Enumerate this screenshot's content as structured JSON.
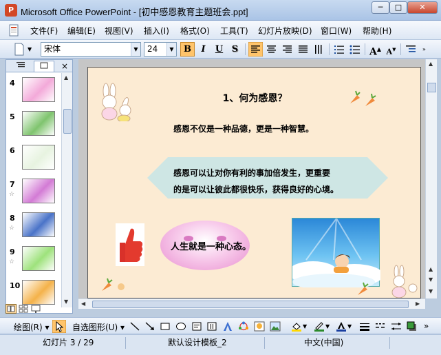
{
  "window": {
    "app_icon": "powerpoint-icon",
    "title": "Microsoft Office PowerPoint - [初中感恩教育主题班会.ppt]"
  },
  "menu": [
    "文件(F)",
    "编辑(E)",
    "视图(V)",
    "插入(I)",
    "格式(O)",
    "工具(T)",
    "幻灯片放映(D)",
    "窗口(W)",
    "帮助(H)"
  ],
  "toolbar": {
    "font_name": "宋体",
    "font_size": "24",
    "bold": "B",
    "italic": "I",
    "underline": "U",
    "shadow": "S",
    "grow_font": "A",
    "shrink_font": "A"
  },
  "panel": {
    "tabs": [
      "outline-tab",
      "slides-tab"
    ],
    "active_tab": "slides-tab",
    "close": "×",
    "slides": [
      {
        "number": "4",
        "star": false,
        "color": "#f3a9d9"
      },
      {
        "number": "5",
        "star": false,
        "color": "#7fc46e"
      },
      {
        "number": "6",
        "star": false,
        "color": "#e7f3e0"
      },
      {
        "number": "7",
        "star": true,
        "color": "#d37bd5"
      },
      {
        "number": "8",
        "star": true,
        "color": "#4a73c8"
      },
      {
        "number": "9",
        "star": true,
        "color": "#9ee27c"
      },
      {
        "number": "10",
        "star": false,
        "color": "#f4b24a"
      }
    ],
    "star_glyph": "☆"
  },
  "slide": {
    "title": "1、何为感恩？",
    "line1": "感恩不仅是一种品德，更是一种智慧。",
    "line2": "感恩可以让对你有利的事加倍发生，更重要",
    "line3": "的是可以让彼此都很快乐，获得良好的心境。",
    "oval_text": "人生就是一种心态。"
  },
  "drawbar": {
    "draw": "绘图(R)",
    "autoshapes": "自选图形(U)"
  },
  "status": {
    "slide_info": "幻灯片 3 / 29",
    "design": "默认设计模板_2",
    "language": "中文(中国)"
  },
  "colors": {
    "slide_bg": "#fcebd3",
    "accent_button": "#ffc46b",
    "close_button": "#c8452d"
  }
}
